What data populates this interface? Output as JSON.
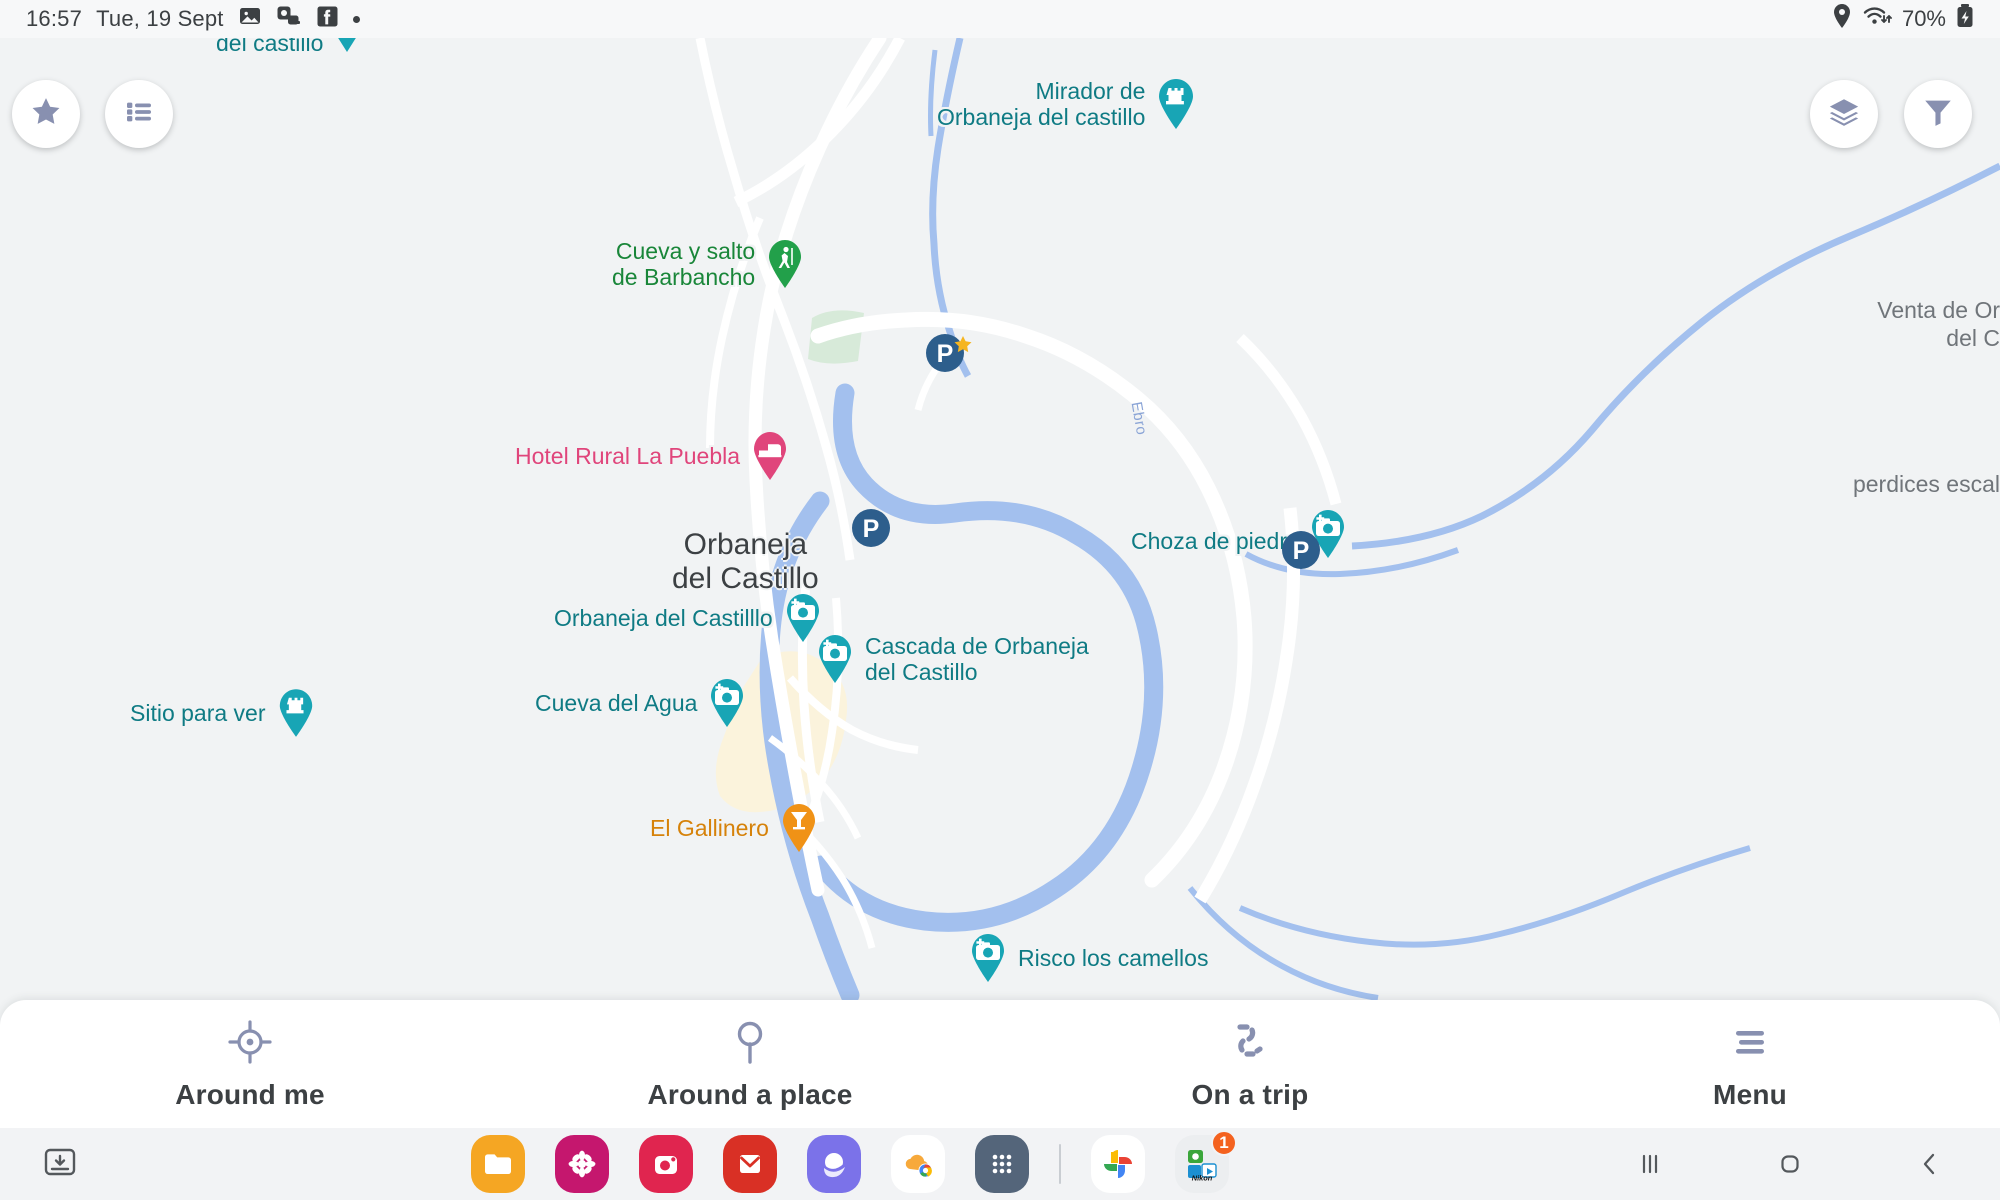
{
  "status_bar": {
    "time": "16:57",
    "date": "Tue, 19 Sept",
    "battery": "70%",
    "icons": [
      "image-icon",
      "photo-stack-icon",
      "facebook-icon",
      "dot-icon"
    ],
    "right_icons": [
      "location-icon",
      "wifi-icon",
      "battery-icon"
    ]
  },
  "map_controls": {
    "favorites_label": "star-icon",
    "list_label": "list-icon",
    "layers_label": "layers-icon",
    "filter_label": "filter-icon"
  },
  "map": {
    "town_label": {
      "line1": "Orbaneja",
      "line2": "del Castillo"
    },
    "river_label": "Ebro",
    "pois": [
      {
        "name": "del castillo",
        "kind": "clipped-label",
        "color": "teal"
      },
      {
        "name": "Mirador de",
        "name2": "Orbaneja del castillo",
        "icon": "castle-pin",
        "color": "teal"
      },
      {
        "name": "Cueva y salto",
        "name2": "de Barbancho",
        "icon": "hiking-pin",
        "color": "green"
      },
      {
        "name": "Hotel Rural La Puebla",
        "icon": "hotel-pin",
        "color": "pink"
      },
      {
        "name": "Orbaneja del Castilllo",
        "icon": "camera-pin",
        "color": "teal"
      },
      {
        "name": "Cascada de Orbaneja",
        "name2": "del Castillo",
        "icon": "camera-pin",
        "color": "teal"
      },
      {
        "name": "Cueva del Agua",
        "icon": "camera-pin",
        "color": "teal"
      },
      {
        "name": "Sitio para ver",
        "icon": "castle-pin",
        "color": "teal"
      },
      {
        "name": "El Gallinero",
        "icon": "restaurant-pin",
        "color": "orange"
      },
      {
        "name": "Choza de piedra",
        "icon": "camera-pin",
        "color": "teal"
      },
      {
        "name": "Risco los camellos",
        "icon": "camera-pin",
        "color": "teal"
      },
      {
        "name": "Venta de Or",
        "name2": "del C",
        "kind": "clipped-label",
        "color": "grey"
      },
      {
        "name": "perdices escal",
        "kind": "clipped-label",
        "color": "grey"
      }
    ],
    "parking_markers": [
      "parking-starred-pin",
      "parking-pin",
      "parking-pin"
    ]
  },
  "labels": {
    "del_castillo_top": "del castillo",
    "mirador_l1": "Mirador de",
    "mirador_l2": "Orbaneja del castillo",
    "cueva_salto_l1": "Cueva y salto",
    "cueva_salto_l2": "de Barbancho",
    "hotel": "Hotel Rural La Puebla",
    "orbaneja_photo": "Orbaneja del Castilllo",
    "cascada_l1": "Cascada de Orbaneja",
    "cascada_l2": "del Castillo",
    "cueva_agua": "Cueva del Agua",
    "sitio": "Sitio para ver",
    "gallinero": "El Gallinero",
    "choza": "Choza de piedra",
    "risco": "Risco los camellos",
    "venta_l1": "Venta de Or",
    "venta_l2": "del C",
    "perdices": "perdices escal"
  },
  "bottom_nav": {
    "items": [
      {
        "label": "Around me",
        "icon": "crosshair-icon"
      },
      {
        "label": "Around a place",
        "icon": "map-pin-icon"
      },
      {
        "label": "On a trip",
        "icon": "route-dots-icon"
      },
      {
        "label": "Menu",
        "icon": "hamburger-icon"
      }
    ]
  },
  "taskbar": {
    "apps": [
      {
        "name": "files-app",
        "color": "#f5a623"
      },
      {
        "name": "gallery-app",
        "color": "#c5176e"
      },
      {
        "name": "camera-app",
        "color": "#e0254f"
      },
      {
        "name": "email-app",
        "color": "#d93025"
      },
      {
        "name": "internet-app",
        "color": "#7b72e9"
      },
      {
        "name": "weather-chrome-app",
        "color": "#ffffff"
      },
      {
        "name": "app-drawer",
        "color": "#54657a"
      },
      {
        "name": "google-photos-app",
        "color": "#ffffff"
      },
      {
        "name": "nikon-snapbridge-app",
        "color": "#f2f3f5",
        "badge": "1",
        "caption": "Nikon"
      }
    ],
    "nav": [
      "recents-button",
      "home-button",
      "back-button"
    ]
  },
  "colors": {
    "map_bg": "#f1f3f4",
    "water": "#a3c0ee",
    "road": "#ffffff",
    "teal_pin": "#18a5b5",
    "green_pin": "#22a04a",
    "pink_pin": "#e0457b",
    "orange_pin": "#f09216",
    "parking_pin": "#2d5e8c",
    "accent_icon": "#8890b0"
  }
}
